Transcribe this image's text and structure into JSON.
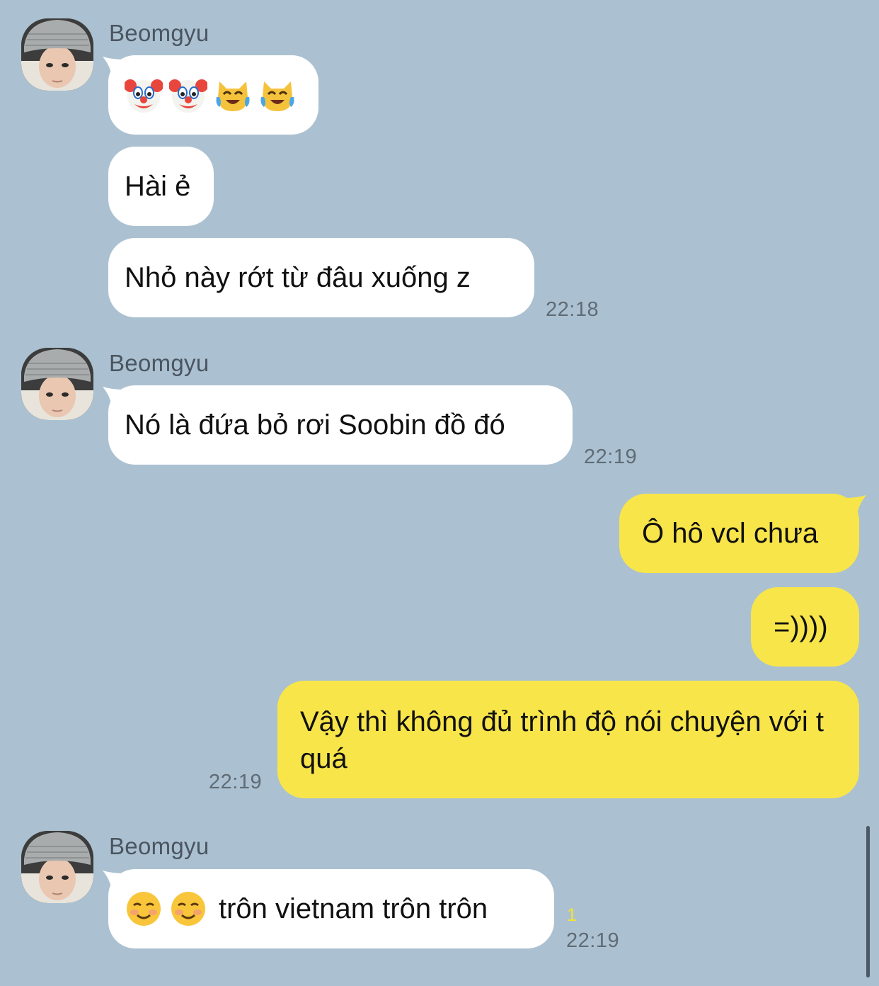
{
  "conversation": {
    "group1": {
      "sender": "Beomgyu",
      "messages": [
        {
          "emojis": [
            "clown-face-emoji",
            "clown-face-emoji",
            "cat-tears-of-joy-emoji",
            "cat-tears-of-joy-emoji"
          ]
        },
        {
          "text": "Hài ẻ"
        },
        {
          "text": "Nhỏ này rớt từ đâu xuống z"
        }
      ],
      "time": "22:18"
    },
    "group2": {
      "sender": "Beomgyu",
      "messages": [
        {
          "text": "Nó là đứa bỏ rơi Soobin đồ đó"
        }
      ],
      "time": "22:19"
    },
    "group3": {
      "messages": [
        {
          "text": "Ô hô vcl chưa"
        },
        {
          "text": "=))))"
        },
        {
          "text": "Vậy thì không đủ trình độ nói chuyện với t quá"
        }
      ],
      "time": "22:19"
    },
    "group4": {
      "sender": "Beomgyu",
      "messages": [
        {
          "emojis": [
            "smiling-face-emoji",
            "smiling-face-emoji"
          ],
          "text": "trôn vietnam trôn trôn"
        }
      ],
      "unread": "1",
      "time": "22:19"
    }
  },
  "colors": {
    "background": "#abc1d1",
    "incoming_bubble": "#ffffff",
    "outgoing_bubble": "#f8e54a",
    "unread_count": "#f5e62b"
  }
}
